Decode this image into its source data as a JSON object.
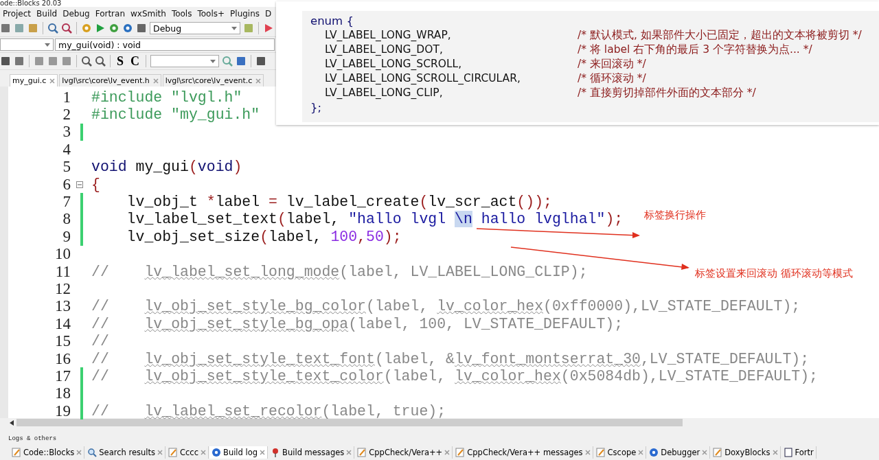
{
  "window": {
    "title": "ode::Blocks 20.03"
  },
  "menu": [
    "Project",
    "Build",
    "Debug",
    "Fortran",
    "wxSmith",
    "Tools",
    "Tools+",
    "Plugins",
    "D"
  ],
  "build_target": {
    "value": "Debug"
  },
  "code_completion": {
    "function": "my_gui(void) : void"
  },
  "toolbar_letters": [
    "S",
    "C"
  ],
  "editor_tabs": [
    {
      "label": "my_gui.c",
      "selected": true
    },
    {
      "label": "lvgl\\src\\core\\lv_event.h",
      "selected": false
    },
    {
      "label": "lvgl\\src\\core\\lv_event.c",
      "selected": false
    }
  ],
  "lines": [
    {
      "number": "1",
      "changed": false,
      "fold": false,
      "tokens": [
        {
          "kind": "pre",
          "text": "#include \"lvgl.h\""
        }
      ]
    },
    {
      "number": "2",
      "changed": false,
      "fold": false,
      "tokens": [
        {
          "kind": "pre",
          "text": "#include \"my_gui.h\""
        }
      ]
    },
    {
      "number": "3",
      "changed": true,
      "fold": false
    },
    {
      "number": "4",
      "changed": false,
      "fold": false
    },
    {
      "number": "5",
      "changed": false,
      "fold": false,
      "tokens": [
        {
          "kind": "kw",
          "text": "void"
        },
        {
          "kind": "id",
          "text": " my_gui"
        },
        {
          "kind": "op",
          "text": "("
        },
        {
          "kind": "kw",
          "text": "void"
        },
        {
          "kind": "op",
          "text": ")"
        }
      ]
    },
    {
      "number": "6",
      "changed": false,
      "fold": true,
      "tokens": [
        {
          "kind": "op",
          "text": "{"
        }
      ]
    },
    {
      "number": "7",
      "changed": true,
      "fold": false,
      "tokens": [
        {
          "kind": "id",
          "text": "    lv_obj_t "
        },
        {
          "kind": "op",
          "text": "*"
        },
        {
          "kind": "id",
          "text": "label "
        },
        {
          "kind": "op",
          "text": "="
        },
        {
          "kind": "id",
          "text": " lv_label_create"
        },
        {
          "kind": "op",
          "text": "("
        },
        {
          "kind": "id",
          "text": "lv_scr_act"
        },
        {
          "kind": "op",
          "text": "());"
        }
      ]
    },
    {
      "number": "8",
      "changed": true,
      "fold": false,
      "tokens": [
        {
          "kind": "id",
          "text": "    lv_label_set_text"
        },
        {
          "kind": "op",
          "text": "("
        },
        {
          "kind": "id",
          "text": "label, "
        },
        {
          "kind": "str",
          "text": "\"hallo lvgl "
        },
        {
          "kind": "sel",
          "text": "\\n"
        },
        {
          "kind": "str",
          "text": " hallo lvglhal\""
        },
        {
          "kind": "op",
          "text": ");"
        }
      ]
    },
    {
      "number": "9",
      "changed": true,
      "fold": false,
      "tokens": [
        {
          "kind": "id",
          "text": "    lv_obj_set_size"
        },
        {
          "kind": "op",
          "text": "("
        },
        {
          "kind": "id",
          "text": "label, "
        },
        {
          "kind": "num",
          "text": "100"
        },
        {
          "kind": "op",
          "text": ","
        },
        {
          "kind": "num",
          "text": "50"
        },
        {
          "kind": "op",
          "text": ");"
        }
      ]
    },
    {
      "number": "10",
      "changed": false,
      "fold": false
    },
    {
      "number": "11",
      "changed": false,
      "fold": false,
      "tokens": [
        {
          "kind": "cmt",
          "text": "//    "
        },
        {
          "kind": "cmtfn",
          "text": "lv_label_set_long_mode"
        },
        {
          "kind": "cmt",
          "text": "(label, LV_LABEL_LONG_CLIP);"
        }
      ]
    },
    {
      "number": "12",
      "changed": false,
      "fold": false
    },
    {
      "number": "13",
      "changed": false,
      "fold": false,
      "tokens": [
        {
          "kind": "cmt",
          "text": "//    "
        },
        {
          "kind": "cmtfn",
          "text": "lv_obj_set_style_bg_color"
        },
        {
          "kind": "cmt",
          "text": "(label, "
        },
        {
          "kind": "cmtfn",
          "text": "lv_color_hex"
        },
        {
          "kind": "cmt",
          "text": "(0xff0000),LV_STATE_DEFAULT);"
        }
      ]
    },
    {
      "number": "14",
      "changed": false,
      "fold": false,
      "tokens": [
        {
          "kind": "cmt",
          "text": "//    "
        },
        {
          "kind": "cmtfn",
          "text": "lv_obj_set_style_bg_opa"
        },
        {
          "kind": "cmt",
          "text": "(label, 100, LV_STATE_DEFAULT);"
        }
      ]
    },
    {
      "number": "15",
      "changed": false,
      "fold": false,
      "tokens": [
        {
          "kind": "cmt",
          "text": "//"
        }
      ]
    },
    {
      "number": "16",
      "changed": false,
      "fold": false,
      "tokens": [
        {
          "kind": "cmt",
          "text": "//    "
        },
        {
          "kind": "cmtfn",
          "text": "lv_obj_set_style_text_font"
        },
        {
          "kind": "cmt",
          "text": "(label, &"
        },
        {
          "kind": "cmtfn",
          "text": "lv_font_montserrat_30"
        },
        {
          "kind": "cmt",
          "text": ",LV_STATE_DEFAULT);"
        }
      ]
    },
    {
      "number": "17",
      "changed": true,
      "fold": false,
      "tokens": [
        {
          "kind": "cmt",
          "text": "//    "
        },
        {
          "kind": "cmtfn",
          "text": "lv_obj_set_style_text_color"
        },
        {
          "kind": "cmt",
          "text": "(label, "
        },
        {
          "kind": "cmtfn",
          "text": "lv_color_hex"
        },
        {
          "kind": "cmt",
          "text": "(0x5084db),LV_STATE_DEFAULT);"
        }
      ]
    },
    {
      "number": "18",
      "changed": true,
      "fold": false
    },
    {
      "number": "19",
      "changed": true,
      "fold": false,
      "tokens": [
        {
          "kind": "cmt",
          "text": "//    "
        },
        {
          "kind": "cmtfn",
          "text": "lv_label_set_recolor"
        },
        {
          "kind": "cmt",
          "text": "(label, true);"
        }
      ]
    }
  ],
  "annotations": [
    "标签换行操作",
    "标签设置来回滚动  循环滚动等模式"
  ],
  "enum_overlay": {
    "open": "enum {",
    "close": "};",
    "entries": [
      {
        "name": "LV_LABEL_LONG_WRAP,",
        "comment": "/* 默认模式, 如果部件大小已固定，超出的文本将被剪切 */"
      },
      {
        "name": "LV_LABEL_LONG_DOT,",
        "comment": "/* 将 label 右下角的最后 3 个字符替换为点... */"
      },
      {
        "name": "LV_LABEL_LONG_SCROLL,",
        "comment": "/* 来回滚动 */"
      },
      {
        "name": "LV_LABEL_LONG_SCROLL_CIRCULAR,",
        "comment": "/* 循环滚动 */"
      },
      {
        "name": "LV_LABEL_LONG_CLIP,",
        "comment": "/* 直接剪切掉部件外面的文本部分 */"
      }
    ]
  },
  "logs": {
    "title": "Logs & others",
    "tabs": [
      {
        "label": "Code::Blocks",
        "kind": "note",
        "selected": false
      },
      {
        "label": "Search results",
        "kind": "search",
        "selected": false
      },
      {
        "label": "Cccc",
        "kind": "note",
        "selected": false
      },
      {
        "label": "Build log",
        "kind": "gear",
        "selected": true
      },
      {
        "label": "Build messages",
        "kind": "pin",
        "selected": false
      },
      {
        "label": "CppCheck/Vera++",
        "kind": "note",
        "selected": false
      },
      {
        "label": "CppCheck/Vera++ messages",
        "kind": "note",
        "selected": false
      },
      {
        "label": "Cscope",
        "kind": "note",
        "selected": false
      },
      {
        "label": "Debugger",
        "kind": "gear",
        "selected": false
      },
      {
        "label": "DoxyBlocks",
        "kind": "note",
        "selected": false
      },
      {
        "label": "Fortr",
        "kind": "doc",
        "selected": false
      }
    ]
  }
}
